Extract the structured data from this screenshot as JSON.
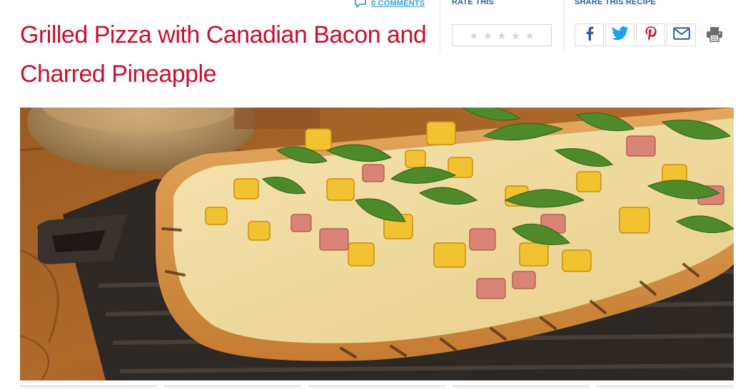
{
  "recipe": {
    "title": "Grilled Pizza with Canadian Bacon and Charred Pineapple"
  },
  "comments": {
    "label": "0 COMMENTS",
    "icon": "comment-icon"
  },
  "rating": {
    "label": "RATE THIS",
    "max_stars": 5,
    "value": 0,
    "icon": "star-icon"
  },
  "share": {
    "label": "SHARE THIS RECIPE",
    "buttons": [
      {
        "icon": "facebook-icon",
        "color": "#3b5998"
      },
      {
        "icon": "twitter-icon",
        "color": "#1da1f2"
      },
      {
        "icon": "pinterest-icon",
        "color": "#c8102e"
      },
      {
        "icon": "email-icon",
        "color": "#2a5f97"
      }
    ],
    "print_icon": "print-icon"
  },
  "hero_image": {
    "subject": "grilled-pizza-photo"
  },
  "colors": {
    "title": "#c8102e",
    "link": "#3aa0d8",
    "label": "#2a5f97"
  }
}
